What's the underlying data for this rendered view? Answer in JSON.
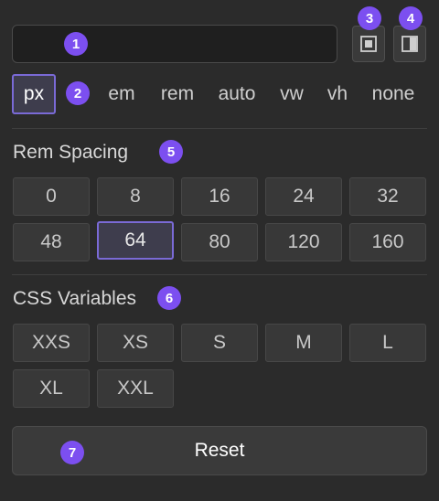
{
  "value_input": {
    "value": ""
  },
  "units": [
    {
      "label": "px",
      "selected": true
    },
    {
      "label": "em",
      "selected": false
    },
    {
      "label": "rem",
      "selected": false
    },
    {
      "label": "auto",
      "selected": false
    },
    {
      "label": "vw",
      "selected": false
    },
    {
      "label": "vh",
      "selected": false
    },
    {
      "label": "none",
      "selected": false
    }
  ],
  "rem_spacing": {
    "title": "Rem Spacing",
    "values": [
      "0",
      "8",
      "16",
      "24",
      "32",
      "48",
      "64",
      "80",
      "120",
      "160"
    ],
    "selected": "64"
  },
  "css_variables": {
    "title": "CSS Variables",
    "values": [
      "XXS",
      "XS",
      "S",
      "M",
      "L",
      "XL",
      "XXL"
    ]
  },
  "reset_label": "Reset",
  "badges": [
    "1",
    "2",
    "3",
    "4",
    "5",
    "6",
    "7"
  ],
  "icons": {
    "padding_all": "padding-all-icon",
    "padding_split": "padding-split-icon"
  },
  "colors": {
    "accent": "#7c4ff0",
    "selected_border": "#7a6ad6",
    "background": "#2b2b2b"
  }
}
